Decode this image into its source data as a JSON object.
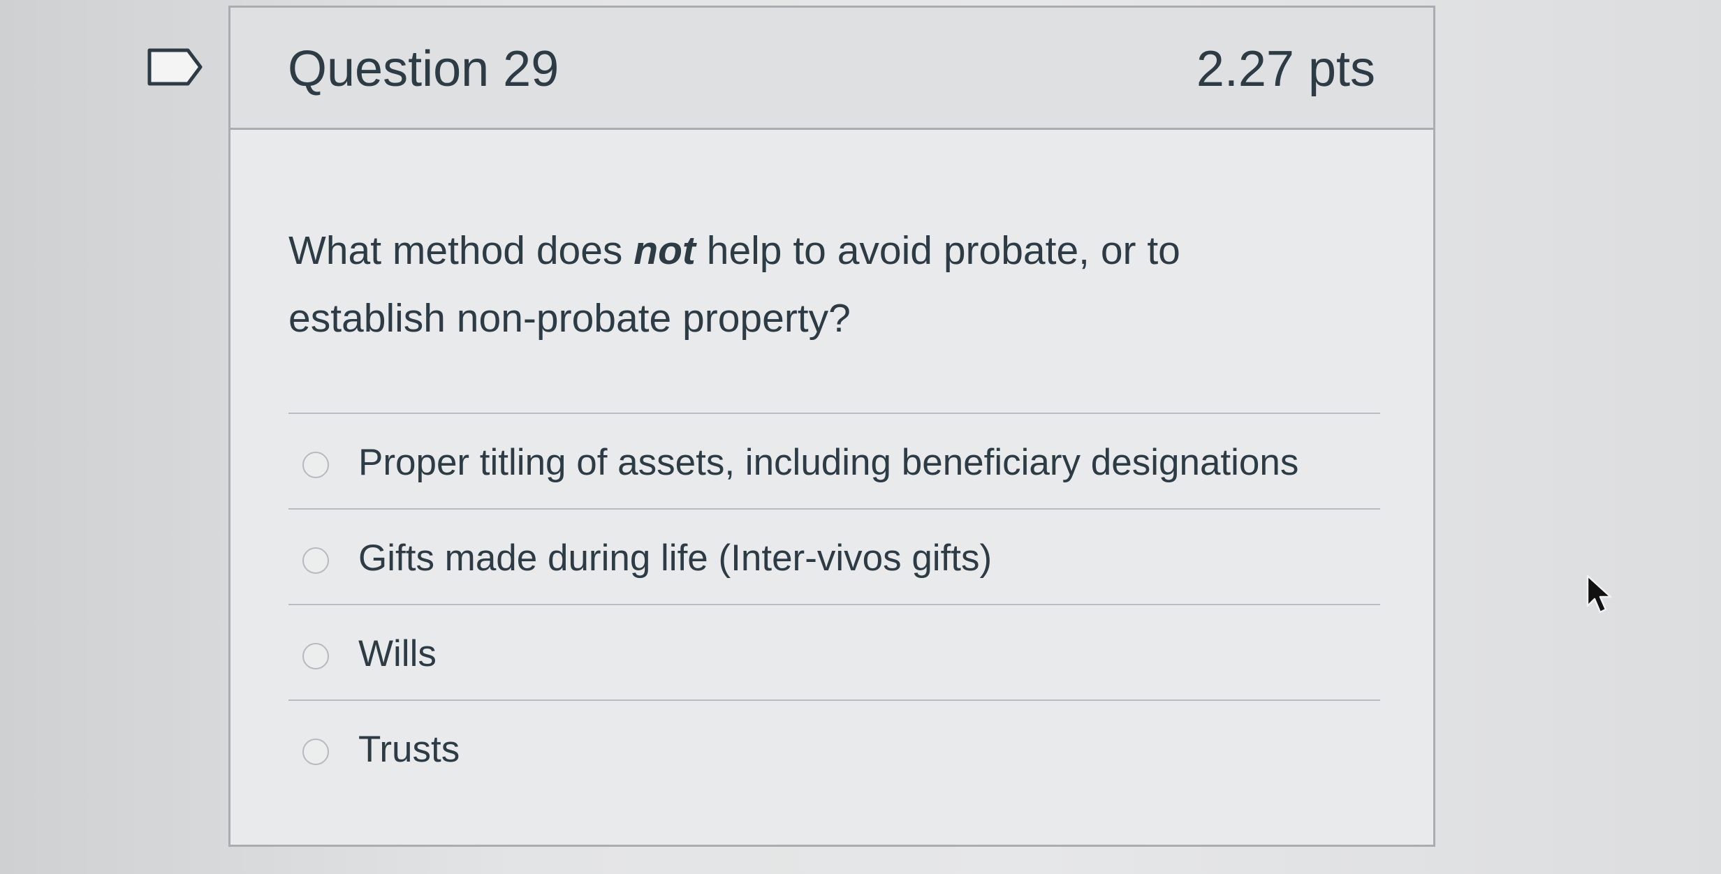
{
  "question": {
    "title": "Question 29",
    "points": "2.27 pts",
    "text_before": "What method does ",
    "text_emphasis": "not",
    "text_after": " help to avoid probate, or to establish non-probate property?"
  },
  "answers": [
    {
      "label": "Proper titling of assets, including beneficiary designations",
      "selected": false
    },
    {
      "label": "Gifts made during life (Inter-vivos gifts)",
      "selected": false
    },
    {
      "label": "Wills",
      "selected": false
    },
    {
      "label": "Trusts",
      "selected": false
    }
  ],
  "icons": {
    "flag": "flag-outline-icon",
    "cursor": "mouse-pointer-icon"
  }
}
